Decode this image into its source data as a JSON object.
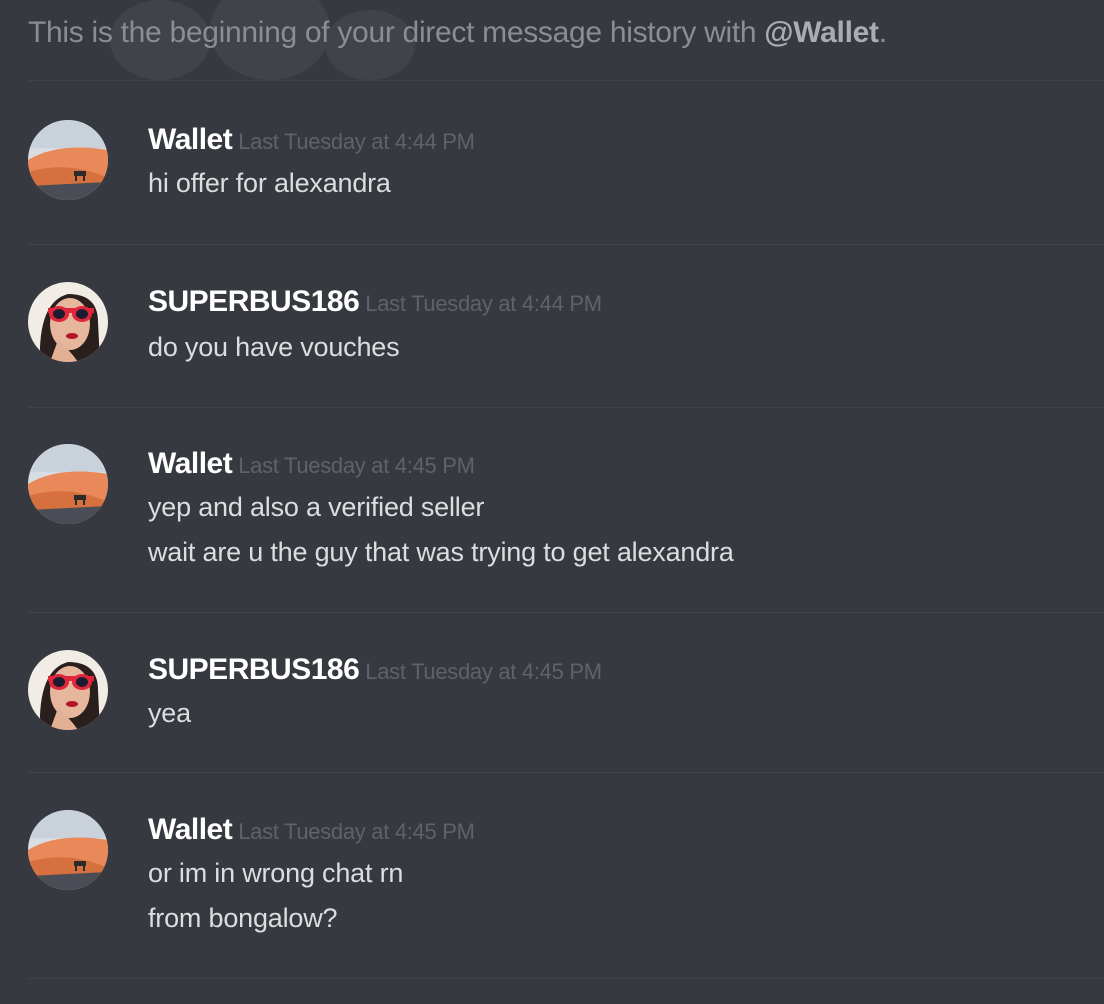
{
  "intro": {
    "prefix": "This is the beginning of your direct message history with ",
    "mention": "@Wallet",
    "suffix": "."
  },
  "messages": [
    {
      "author": "Wallet",
      "avatar": "desert-landscape-avatar",
      "timestamp": "Last Tuesday at 4:44 PM",
      "lines": [
        "hi offer for alexandra"
      ]
    },
    {
      "author": "SUPERBUS186",
      "avatar": "woman-red-sunglasses-avatar",
      "timestamp": "Last Tuesday at 4:44 PM",
      "lines": [
        "do you have vouches"
      ]
    },
    {
      "author": "Wallet",
      "avatar": "desert-landscape-avatar",
      "timestamp": "Last Tuesday at 4:45 PM",
      "lines": [
        "yep and also a verified seller",
        "wait are u the guy that was trying to get alexandra"
      ]
    },
    {
      "author": "SUPERBUS186",
      "avatar": "woman-red-sunglasses-avatar",
      "timestamp": "Last Tuesday at 4:45 PM",
      "lines": [
        "yea"
      ]
    },
    {
      "author": "Wallet",
      "avatar": "desert-landscape-avatar",
      "timestamp": "Last Tuesday at 4:45 PM",
      "lines": [
        "or im in wrong chat rn",
        "from bongalow?"
      ]
    }
  ],
  "colors": {
    "background": "#36393f",
    "username": "#ffffff",
    "message_text": "#dcddde",
    "timestamp": "#5f6268",
    "intro_text": "#8a8d92"
  }
}
